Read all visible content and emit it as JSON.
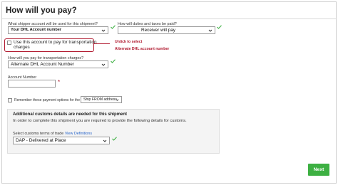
{
  "page": {
    "title": "How will you pay?"
  },
  "shipper_account": {
    "label": "What shipper account will be used for this shipment?",
    "value": "Your DHL Account number"
  },
  "duties_taxes": {
    "label": "How will duties and taxes be paid?",
    "value": "Receiver will pay"
  },
  "use_account_checkbox": {
    "label_line1": "Use this account to pay for transportation",
    "label_line2": "charges",
    "checked": false
  },
  "annotation": {
    "line1": "Untick to select",
    "line2": "Alternate DHL account number"
  },
  "transport_charges": {
    "label": "How will you pay for transportation charges?",
    "value": "Alternate DHL Account Number"
  },
  "account_number": {
    "label": "Account Number",
    "value": "",
    "required_mark": "*"
  },
  "remember_payment": {
    "label": "Remember these payment options for the",
    "button": "Ship FROM address",
    "checked": false
  },
  "customs_box": {
    "title": "Additional customs details are needed for this shipment",
    "description": "In order to complete this shipment you are required to provide the following details for customs.",
    "terms_label": "Select customs terms of trade",
    "terms_link": "View Definitions",
    "terms_value": "DAP - Delivered at Place"
  },
  "footer": {
    "next_label": "Next"
  },
  "colors": {
    "valid_check": "#3db042",
    "annotation": "#b0182e",
    "next_button": "#3db042",
    "link": "#2a66c9"
  },
  "icons": [
    "chevron-down-icon",
    "checkmark-icon",
    "checkbox-icon"
  ]
}
